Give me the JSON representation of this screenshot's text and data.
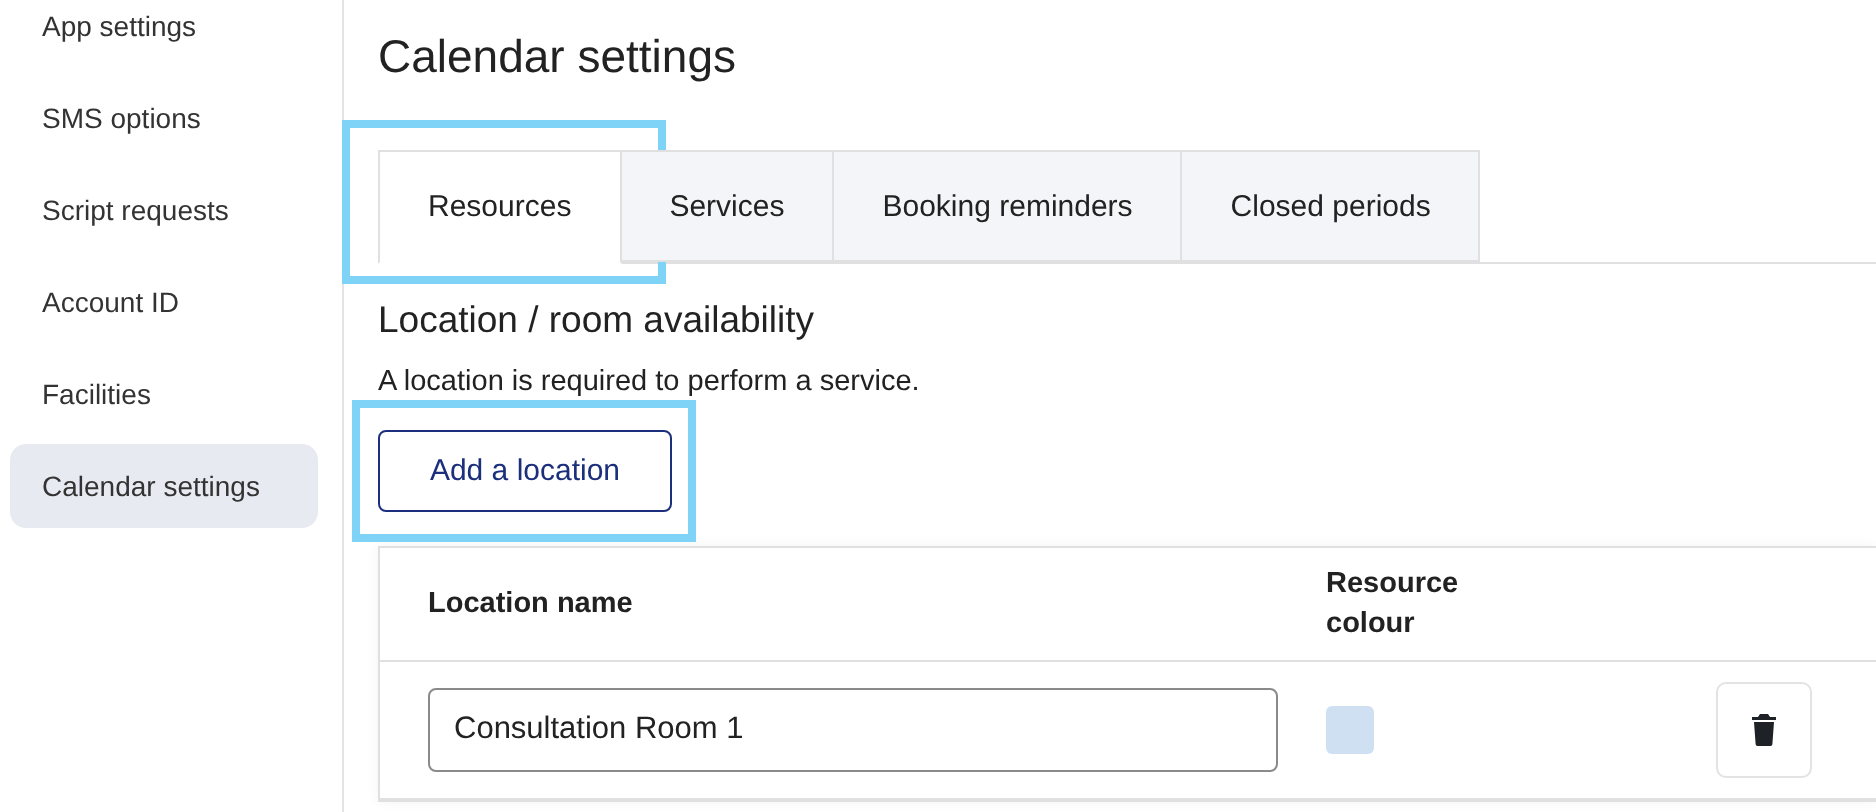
{
  "sidebar": {
    "items": [
      {
        "label": "App settings",
        "selected": false
      },
      {
        "label": "SMS options",
        "selected": false
      },
      {
        "label": "Script requests",
        "selected": false
      },
      {
        "label": "Account ID",
        "selected": false
      },
      {
        "label": "Facilities",
        "selected": false
      },
      {
        "label": "Calendar settings",
        "selected": true
      }
    ]
  },
  "page_title": "Calendar settings",
  "tabs": [
    {
      "label": "Resources",
      "selected": true,
      "highlighted": true
    },
    {
      "label": "Services",
      "selected": false,
      "highlighted": false
    },
    {
      "label": "Booking reminders",
      "selected": false,
      "highlighted": false
    },
    {
      "label": "Closed periods",
      "selected": false,
      "highlighted": false
    }
  ],
  "section": {
    "heading": "Location / room availability",
    "description": "A location is required to perform a service.",
    "add_button": {
      "label": "Add a location",
      "highlighted": true
    }
  },
  "table": {
    "columns": [
      "Location name",
      "Resource colour"
    ],
    "rows": [
      {
        "location_name": "Consultation Room 1",
        "color": "#cfe0f2"
      }
    ]
  }
}
